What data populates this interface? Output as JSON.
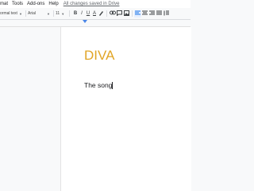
{
  "menubar": {
    "items": [
      "mat",
      "Tools",
      "Add-ons",
      "Help"
    ],
    "saved_status": "All changes saved in Drive"
  },
  "toolbar": {
    "style": "ormal text",
    "font": "Arial",
    "size": "11",
    "bold": "B",
    "italic": "I",
    "underline": "U",
    "text_color": "A"
  },
  "document": {
    "title": "DIVA",
    "title_color": "#e1a526",
    "body": "The song"
  }
}
